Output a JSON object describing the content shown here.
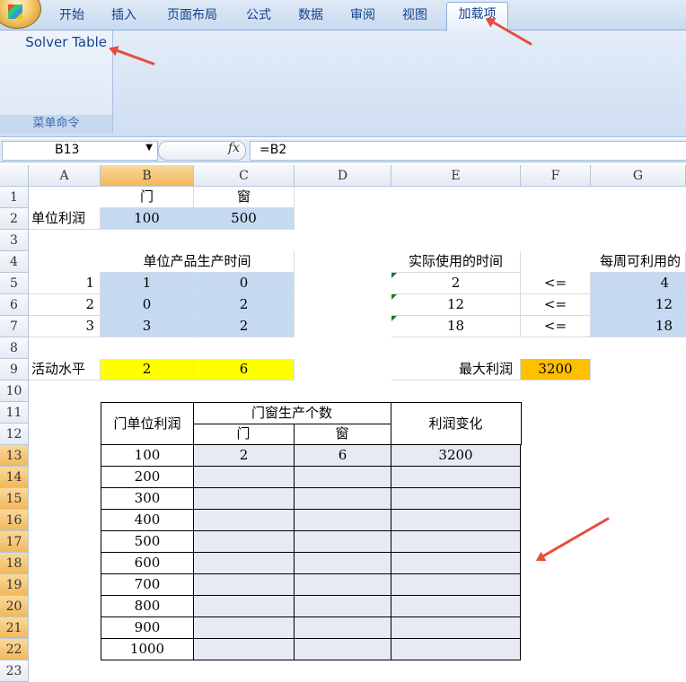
{
  "ribbon": {
    "tabs": [
      "开始",
      "插入",
      "页面布局",
      "公式",
      "数据",
      "审阅",
      "视图",
      "加载项"
    ],
    "active_tab": "加载项",
    "group_command": "Solver Table",
    "group_label": "菜单命令"
  },
  "formula_bar": {
    "name_box": "B13",
    "fx_label": "fx",
    "formula": "=B2"
  },
  "columns": [
    "A",
    "B",
    "C",
    "D",
    "E",
    "F",
    "G"
  ],
  "rows": [
    "1",
    "2",
    "3",
    "4",
    "5",
    "6",
    "7",
    "8",
    "9",
    "10",
    "11",
    "12",
    "13",
    "14",
    "15",
    "16",
    "17",
    "18",
    "19",
    "20",
    "21",
    "22",
    "23"
  ],
  "sheet": {
    "r1": {
      "b": "门",
      "c": "窗"
    },
    "r2": {
      "a": "单位利润",
      "b": "100",
      "c": "500"
    },
    "r4": {
      "bc": "单位产品生产时间",
      "e": "实际使用的时间",
      "g": "每周可利用的"
    },
    "r5": {
      "a": "1",
      "b": "1",
      "c": "0",
      "e": "2",
      "f": "<=",
      "g": "4"
    },
    "r6": {
      "a": "2",
      "b": "0",
      "c": "2",
      "e": "12",
      "f": "<=",
      "g": "12"
    },
    "r7": {
      "a": "3",
      "b": "3",
      "c": "2",
      "e": "18",
      "f": "<=",
      "g": "18"
    },
    "r9": {
      "a": "活动水平",
      "b": "2",
      "c": "6",
      "e": "最大利润",
      "f": "3200"
    }
  },
  "table": {
    "head_left": "门单位利润",
    "head_mid": "门窗生产个数",
    "head_c": "门",
    "head_d": "窗",
    "head_right": "利润变化",
    "first_row": {
      "c": "2",
      "d": "6",
      "e": "3200"
    },
    "b_values": [
      "100",
      "200",
      "300",
      "400",
      "500",
      "600",
      "700",
      "800",
      "900",
      "1000"
    ]
  },
  "colors": {
    "input_blue": "#c5d9f1",
    "highlight_yellow": "#ffff00",
    "result_orange": "#ffc000",
    "annotation_red": "#e84c3d"
  }
}
